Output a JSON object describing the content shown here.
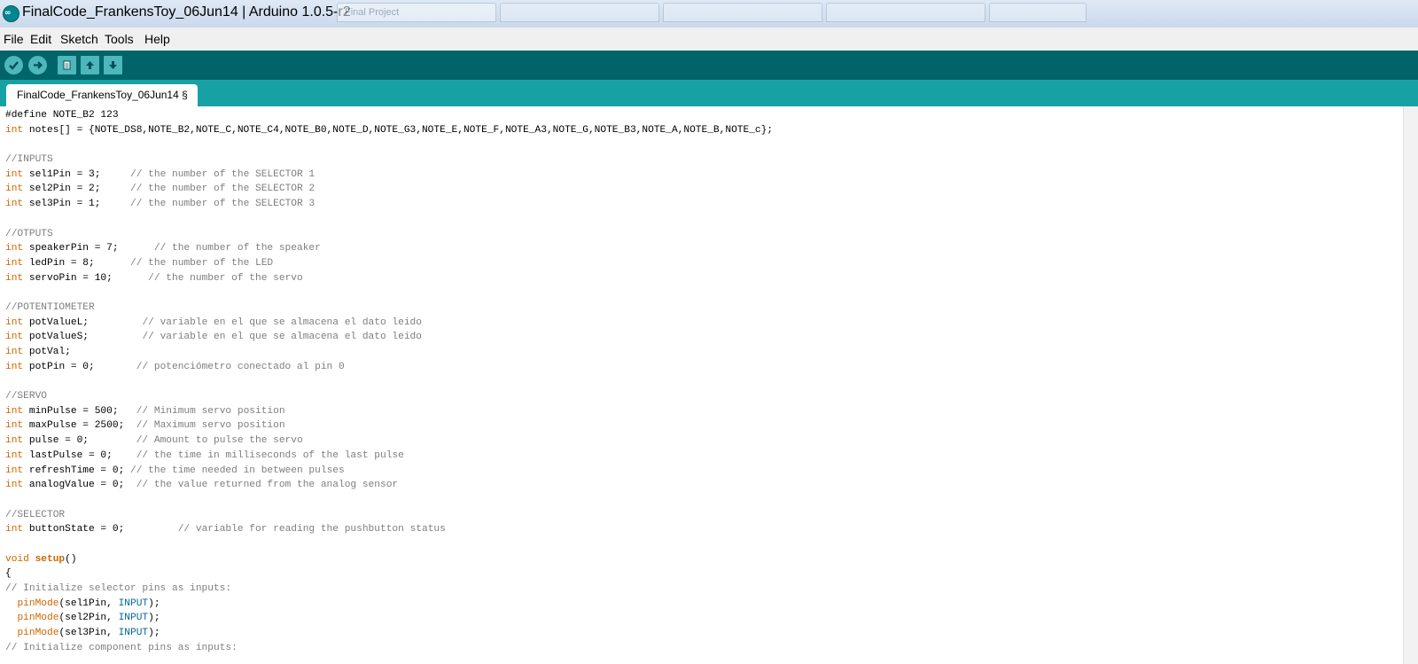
{
  "window": {
    "title": "FinalCode_FrankensToy_06Jun14 | Arduino 1.0.5-r2",
    "icon": "arduino-icon",
    "background_tabs": [
      "Final Project",
      "",
      "",
      "",
      ""
    ]
  },
  "menu": {
    "items": [
      "File",
      "Edit",
      "Sketch",
      "Tools",
      "Help"
    ]
  },
  "toolbar": {
    "buttons": [
      {
        "name": "verify",
        "icon": "check-icon"
      },
      {
        "name": "upload",
        "icon": "arrow-right-icon"
      },
      {
        "name": "new",
        "icon": "new-file-icon"
      },
      {
        "name": "open",
        "icon": "arrow-up-icon"
      },
      {
        "name": "save",
        "icon": "arrow-down-icon"
      }
    ]
  },
  "tabs": {
    "active": "FinalCode_FrankensToy_06Jun14 §"
  },
  "colors": {
    "toolbar": "#006468",
    "tabbar": "#17a1a5",
    "keyword": "#cc6600",
    "comment": "#7e7e7e",
    "constant": "#006699"
  },
  "code_lines": [
    [
      {
        "t": "#define NOTE_B2 123"
      }
    ],
    [
      {
        "t": "int",
        "c": "kw"
      },
      {
        "t": " notes[] = {NOTE_DS8,NOTE_B2,NOTE_C,NOTE_C4,NOTE_B0,NOTE_D,NOTE_G3,NOTE_E,NOTE_F,NOTE_A3,NOTE_G,NOTE_B3,NOTE_A,NOTE_B,NOTE_c};"
      }
    ],
    [],
    [
      {
        "t": "//INPUTS",
        "c": "cm"
      }
    ],
    [
      {
        "t": "int",
        "c": "kw"
      },
      {
        "t": " sel1Pin = 3;     "
      },
      {
        "t": "// the number of the SELECTOR 1",
        "c": "cm"
      }
    ],
    [
      {
        "t": "int",
        "c": "kw"
      },
      {
        "t": " sel2Pin = 2;     "
      },
      {
        "t": "// the number of the SELECTOR 2",
        "c": "cm"
      }
    ],
    [
      {
        "t": "int",
        "c": "kw"
      },
      {
        "t": " sel3Pin = 1;     "
      },
      {
        "t": "// the number of the SELECTOR 3",
        "c": "cm"
      }
    ],
    [],
    [
      {
        "t": "//OTPUTS",
        "c": "cm"
      }
    ],
    [
      {
        "t": "int",
        "c": "kw"
      },
      {
        "t": " speakerPin = 7;      "
      },
      {
        "t": "// the number of the speaker",
        "c": "cm"
      }
    ],
    [
      {
        "t": "int",
        "c": "kw"
      },
      {
        "t": " ledPin = 8;      "
      },
      {
        "t": "// the number of the LED",
        "c": "cm"
      }
    ],
    [
      {
        "t": "int",
        "c": "kw"
      },
      {
        "t": " servoPin = 10;      "
      },
      {
        "t": "// the number of the servo",
        "c": "cm"
      }
    ],
    [],
    [
      {
        "t": "//POTENTIOMETER",
        "c": "cm"
      }
    ],
    [
      {
        "t": "int",
        "c": "kw"
      },
      {
        "t": " potValueL;         "
      },
      {
        "t": "// variable en el que se almacena el dato leido",
        "c": "cm"
      }
    ],
    [
      {
        "t": "int",
        "c": "kw"
      },
      {
        "t": " potValueS;         "
      },
      {
        "t": "// variable en el que se almacena el dato leido",
        "c": "cm"
      }
    ],
    [
      {
        "t": "int",
        "c": "kw"
      },
      {
        "t": " potVal;"
      }
    ],
    [
      {
        "t": "int",
        "c": "kw"
      },
      {
        "t": " potPin = 0;       "
      },
      {
        "t": "// potenciómetro conectado al pin 0",
        "c": "cm"
      }
    ],
    [],
    [
      {
        "t": "//SERVO",
        "c": "cm"
      }
    ],
    [
      {
        "t": "int",
        "c": "kw"
      },
      {
        "t": " minPulse = 500;   "
      },
      {
        "t": "// Minimum servo position",
        "c": "cm"
      }
    ],
    [
      {
        "t": "int",
        "c": "kw"
      },
      {
        "t": " maxPulse = 2500;  "
      },
      {
        "t": "// Maximum servo position",
        "c": "cm"
      }
    ],
    [
      {
        "t": "int",
        "c": "kw"
      },
      {
        "t": " pulse = 0;        "
      },
      {
        "t": "// Amount to pulse the servo",
        "c": "cm"
      }
    ],
    [
      {
        "t": "int",
        "c": "kw"
      },
      {
        "t": " lastPulse = 0;    "
      },
      {
        "t": "// the time in milliseconds of the last pulse",
        "c": "cm"
      }
    ],
    [
      {
        "t": "int",
        "c": "kw"
      },
      {
        "t": " refreshTime = 0; "
      },
      {
        "t": "// the time needed in between pulses",
        "c": "cm"
      }
    ],
    [
      {
        "t": "int",
        "c": "kw"
      },
      {
        "t": " analogValue = 0;  "
      },
      {
        "t": "// the value returned from the analog sensor",
        "c": "cm"
      }
    ],
    [],
    [
      {
        "t": "//SELECTOR",
        "c": "cm"
      }
    ],
    [
      {
        "t": "int",
        "c": "kw"
      },
      {
        "t": " buttonState = 0;         "
      },
      {
        "t": "// variable for reading the pushbutton status",
        "c": "cm"
      }
    ],
    [],
    [
      {
        "t": "void",
        "c": "kw"
      },
      {
        "t": " "
      },
      {
        "t": "setup",
        "c": "fn"
      },
      {
        "t": "()"
      }
    ],
    [
      {
        "t": "{"
      }
    ],
    [
      {
        "t": "// Initialize selector pins as inputs:",
        "c": "cm"
      }
    ],
    [
      {
        "t": "  "
      },
      {
        "t": "pinMode",
        "c": "kw"
      },
      {
        "t": "(sel1Pin, "
      },
      {
        "t": "INPUT",
        "c": "const"
      },
      {
        "t": ");"
      }
    ],
    [
      {
        "t": "  "
      },
      {
        "t": "pinMode",
        "c": "kw"
      },
      {
        "t": "(sel2Pin, "
      },
      {
        "t": "INPUT",
        "c": "const"
      },
      {
        "t": ");"
      }
    ],
    [
      {
        "t": "  "
      },
      {
        "t": "pinMode",
        "c": "kw"
      },
      {
        "t": "(sel3Pin, "
      },
      {
        "t": "INPUT",
        "c": "const"
      },
      {
        "t": ");"
      }
    ],
    [
      {
        "t": "// Initialize component pins as inputs:",
        "c": "cm"
      }
    ]
  ]
}
